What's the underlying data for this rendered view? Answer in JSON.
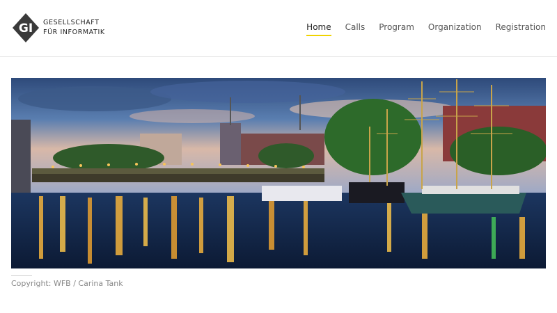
{
  "brand": {
    "line1": "GESELLSCHAFT",
    "line2": "FÜR INFORMATIK",
    "mark_text": "GI",
    "color": "#3a3a3a"
  },
  "nav": {
    "items": [
      {
        "label": "Home",
        "active": true
      },
      {
        "label": "Calls",
        "active": false
      },
      {
        "label": "Program",
        "active": false
      },
      {
        "label": "Organization",
        "active": false
      },
      {
        "label": "Registration",
        "active": false
      }
    ],
    "accent": "#f0d300"
  },
  "hero": {
    "subject": "Bremen harbor at dusk with tall ships and bridge"
  },
  "credit": {
    "text": "Copyright: WFB / Carina Tank"
  }
}
